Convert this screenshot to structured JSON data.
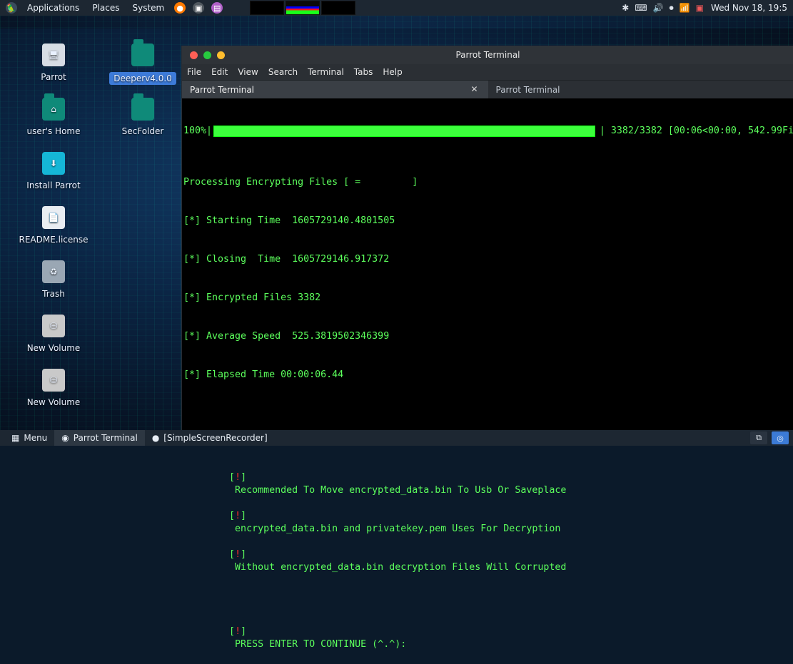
{
  "top_panel": {
    "apps_label": "Applications",
    "places_label": "Places",
    "system_label": "System",
    "datetime": "Wed Nov 18, 19:5"
  },
  "desktop": {
    "left_column": [
      {
        "label": "Parrot",
        "icon": "computer-icon"
      },
      {
        "label": "user's Home",
        "icon": "home-folder-icon"
      },
      {
        "label": "Install Parrot",
        "icon": "install-icon"
      },
      {
        "label": "README.license",
        "icon": "document-icon"
      },
      {
        "label": "Trash",
        "icon": "trash-icon"
      },
      {
        "label": "New Volume",
        "icon": "drive-icon"
      },
      {
        "label": "New Volume",
        "icon": "drive-icon"
      }
    ],
    "right_column": [
      {
        "label": "Deeperv4.0.0",
        "icon": "folder-icon",
        "selected": true
      },
      {
        "label": "SecFolder",
        "icon": "folder-icon",
        "selected": false
      }
    ]
  },
  "terminal": {
    "window_title": "Parrot Terminal",
    "menu": [
      "File",
      "Edit",
      "View",
      "Search",
      "Terminal",
      "Tabs",
      "Help"
    ],
    "tabs": [
      {
        "label": "Parrot Terminal",
        "active": true
      },
      {
        "label": "Parrot Terminal",
        "active": false
      }
    ],
    "progress": {
      "prefix": "100%|",
      "suffix": "| 3382/3382 [00:06<00:00, 542.99Fi",
      "percent": 100
    },
    "lines": [
      {
        "text": "Processing Encrypting Files [ =         ]"
      },
      {
        "text": "[*] Starting Time  1605729140.4801505"
      },
      {
        "text": "[*] Closing  Time  1605729146.917372"
      },
      {
        "text": "[*] Encrypted Files 3382"
      },
      {
        "text": "[*] Average Speed  525.3819502346399"
      },
      {
        "text": "[*] Elapsed Time 00:00:06.44"
      },
      {
        "text": ""
      },
      {
        "text": "[!] Recommended To Move encrypted_data.bin To Usb Or Saveplace"
      },
      {
        "text": "[!] encrypted_data.bin and privatekey.pem Uses For Decryption"
      },
      {
        "text": "[!] Without encrypted_data.bin decryption Files Will Corrupted"
      },
      {
        "text": ""
      },
      {
        "text": "[!] PRESS ENTER TO CONTINUE (^.^):"
      }
    ]
  },
  "bottom_panel": {
    "menu_label": "Menu",
    "task_active": "Parrot Terminal",
    "task_other": "[SimpleScreenRecorder]"
  },
  "colors": {
    "terminal_green": "#5cff5c",
    "progress_green": "#3cff3c",
    "panel_bg": "#1d2732",
    "alert_red": "#ff2a2a"
  }
}
